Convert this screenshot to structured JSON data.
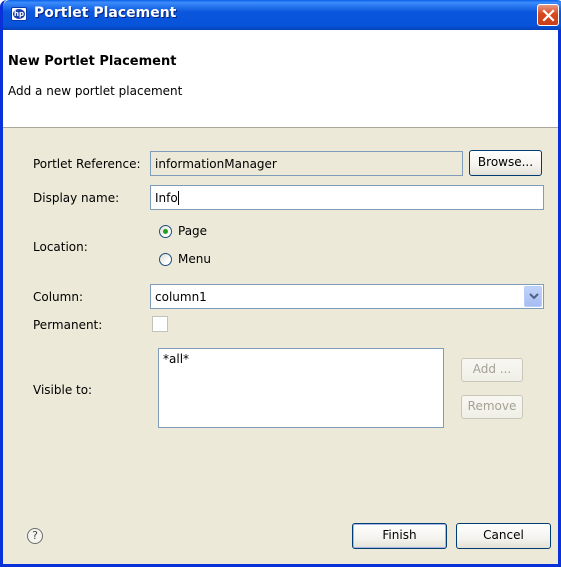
{
  "window": {
    "title": "Portlet Placement"
  },
  "banner": {
    "title": "New Portlet Placement",
    "subtitle": "Add a new portlet placement"
  },
  "form": {
    "portlet_reference": {
      "label": "Portlet Reference:",
      "value": "informationManager",
      "browse_label": "Browse..."
    },
    "display_name": {
      "label": "Display name:",
      "value": "Info"
    },
    "location": {
      "label": "Location:",
      "options": [
        {
          "label": "Page",
          "selected": true
        },
        {
          "label": "Menu",
          "selected": false
        }
      ]
    },
    "column": {
      "label": "Column:",
      "value": "column1"
    },
    "permanent": {
      "label": "Permanent:",
      "checked": false
    },
    "visible_to": {
      "label": "Visible to:",
      "items": [
        "*all*"
      ],
      "add_label": "Add ...",
      "remove_label": "Remove"
    }
  },
  "footer": {
    "help_icon": "?",
    "finish_label": "Finish",
    "cancel_label": "Cancel"
  },
  "icons": {
    "app": "hp-logo-icon",
    "close": "close-icon",
    "dropdown": "chevron-down-icon",
    "help": "help-icon"
  },
  "colors": {
    "titlebar": "#0a56dc",
    "dialog_bg": "#ece9d8",
    "close_button": "#d9481d",
    "radio_selected": "#21a121"
  }
}
